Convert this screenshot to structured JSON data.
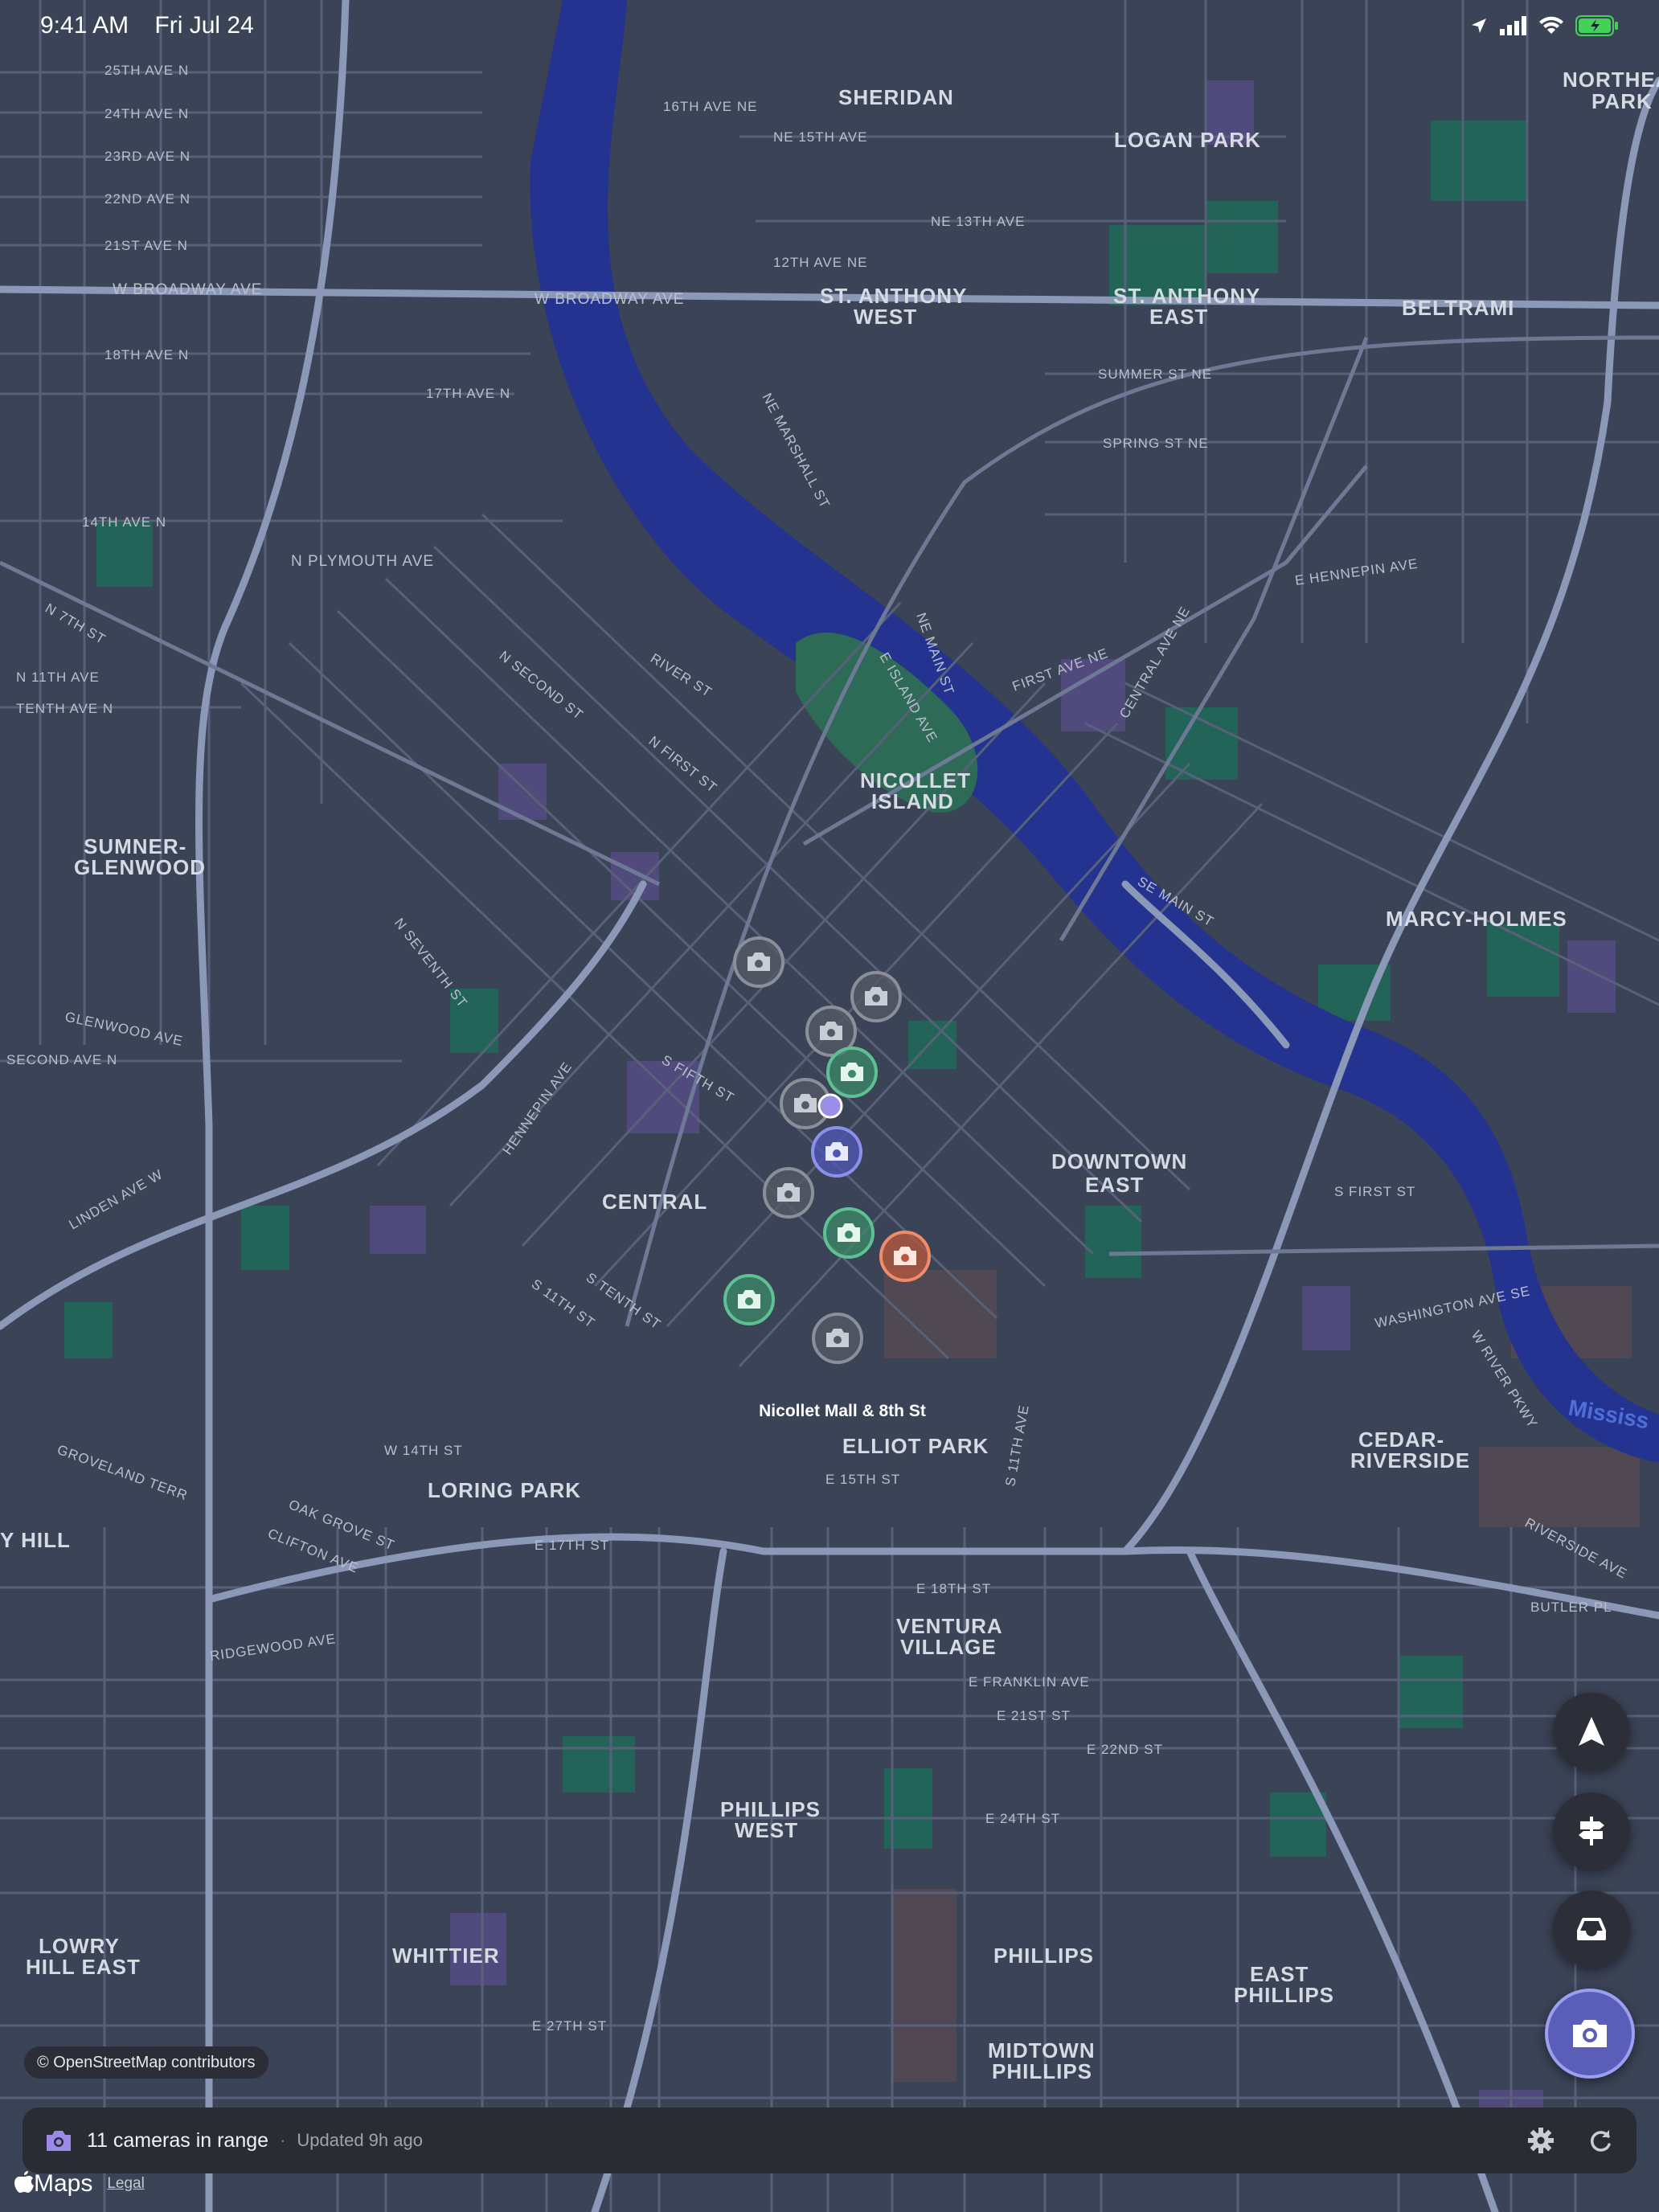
{
  "status_bar": {
    "time": "9:41 AM",
    "date": "Fri Jul 24"
  },
  "map": {
    "neighborhoods": [
      "SHERIDAN",
      "LOGAN PARK",
      "NORTHEAST",
      "PARK",
      "ST. ANTHONY",
      "WEST",
      "ST. ANTHONY",
      "EAST",
      "BELTRAMI",
      "NICOLLET",
      "ISLAND",
      "SUMNER-",
      "GLENWOOD",
      "MARCY-HOLMES",
      "DOWNTOWN",
      "EAST",
      "CENTRAL",
      "CEDAR-",
      "RIVERSIDE",
      "ELLIOT PARK",
      "LORING PARK",
      "VENTURA",
      "VILLAGE",
      "PHILLIPS",
      "WEST",
      "WHITTIER",
      "PHILLIPS",
      "MIDTOWN",
      "PHILLIPS",
      "EAST",
      "PHILLIPS",
      "LOWRY",
      "HILL EAST",
      "Y HILL"
    ],
    "streets": [
      "25TH AVE N",
      "24TH AVE N",
      "23RD AVE N",
      "22ND AVE N",
      "21ST AVE N",
      "W BROADWAY AVE",
      "18TH AVE N",
      "17TH AVE N",
      "14TH AVE N",
      "N PLYMOUTH AVE",
      "N 7TH ST",
      "N 11TH AVE",
      "TENTH AVE N",
      "16TH AVE NE",
      "NE 15TH AVE",
      "NE 13TH AVE",
      "12TH AVE NE",
      "W BROADWAY AVE",
      "SUMMER ST NE",
      "SPRING ST NE",
      "E HENNEPIN AVE",
      "FIRST AVE NE",
      "CENTRAL AVE NE",
      "SE MAIN ST",
      "WASHINGTON AVE SE",
      "S FIRST ST",
      "GLENWOOD AVE",
      "SECOND AVE N",
      "LINDEN AVE W",
      "HENNEPIN AVE",
      "S FIFTH ST",
      "S TENTH ST",
      "S 11TH ST",
      "W 14TH ST",
      "E 15TH ST",
      "E 17TH ST",
      "E 18TH ST",
      "E FRANKLIN AVE",
      "E 21ST ST",
      "E 22ND ST",
      "E 24TH ST",
      "E 27TH ST",
      "RIDGEWOOD AVE",
      "GROVELAND TERR",
      "OAK GROVE ST",
      "CLIFTON AVE",
      "BUTLER PL",
      "RIVERSIDE AVE",
      "W RIVER PKWY",
      "E ISLAND AVE",
      "NE MAIN ST",
      "NE MARSHALL ST",
      "N SECOND ST",
      "N FIRST ST",
      "N SEVENTH ST",
      "S 11TH AVE",
      "RIVER ST"
    ],
    "place_label": "Nicollet Mall & 8th St",
    "water_label": "Mississ",
    "cameras": [
      {
        "status": "inactive"
      },
      {
        "status": "inactive"
      },
      {
        "status": "inactive"
      },
      {
        "status": "active"
      },
      {
        "status": "inactive"
      },
      {
        "status": "selected"
      },
      {
        "status": "inactive"
      },
      {
        "status": "active"
      },
      {
        "status": "alert"
      },
      {
        "status": "active"
      },
      {
        "status": "inactive"
      }
    ]
  },
  "controls": {
    "locate": "location-arrow-icon",
    "directions": "signpost-icon",
    "inbox": "tray-icon",
    "camera": "camera-icon"
  },
  "attribution": "© OpenStreetMap contributors",
  "bottom_bar": {
    "count": "11 cameras in range",
    "separator": "·",
    "updated": "Updated 9h ago"
  },
  "brand": {
    "name": "Maps",
    "legal": "Legal"
  },
  "colors": {
    "accent": "#8a7fe6",
    "active": "#3fb07a",
    "alert": "#e0704f",
    "water": "#24338f",
    "park": "#1f6a58"
  }
}
